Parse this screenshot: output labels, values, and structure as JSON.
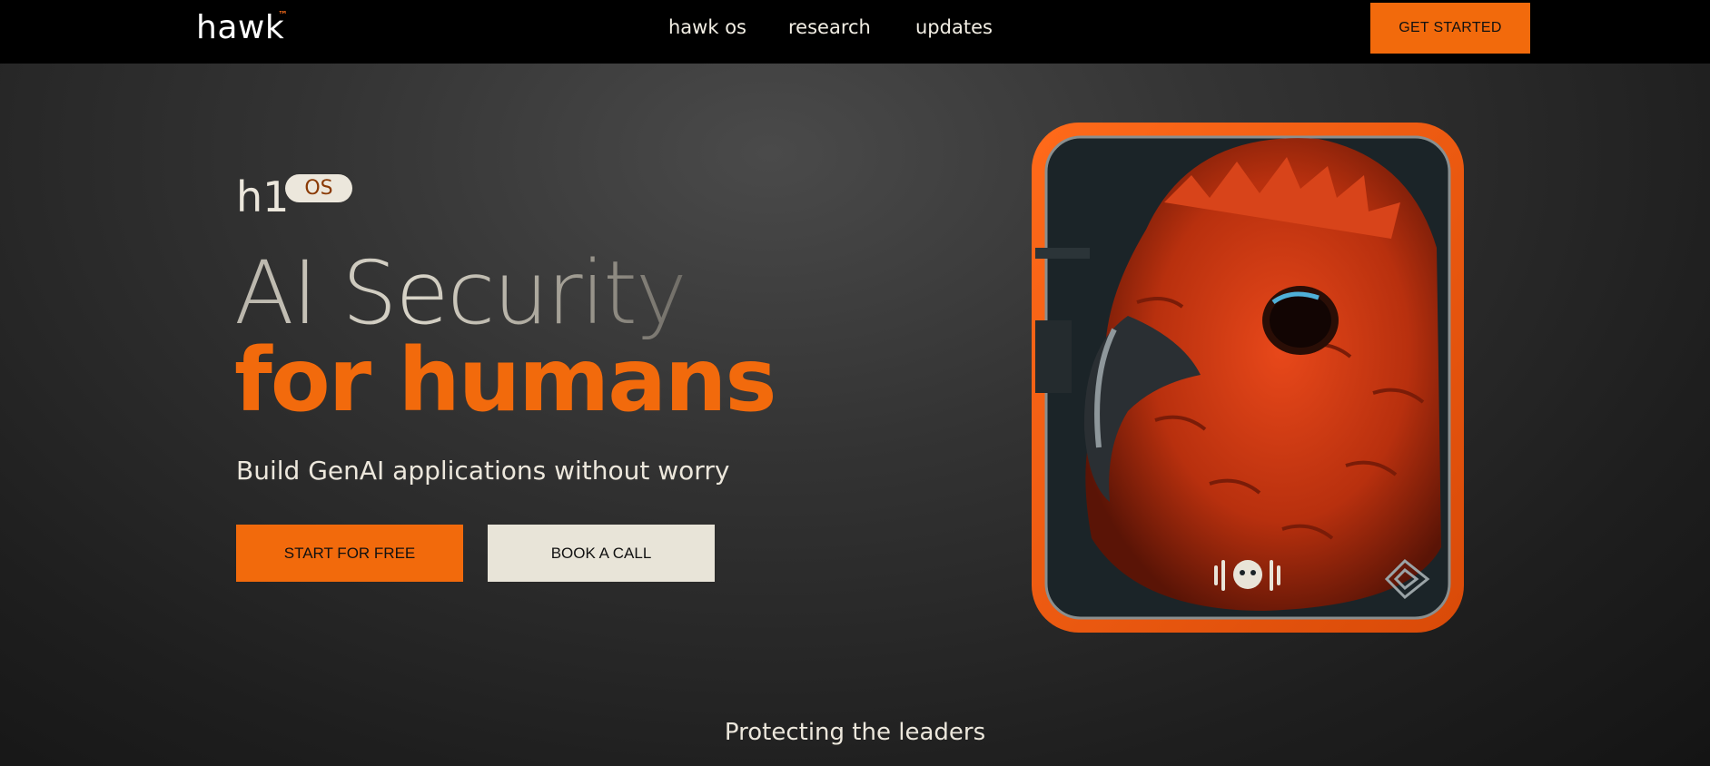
{
  "header": {
    "logo": "hawk",
    "logo_mark": "™",
    "nav": [
      "hawk os",
      "research",
      "updates"
    ],
    "cta": "GET STARTED"
  },
  "hero": {
    "tag": "h1",
    "tag_pill": "OS",
    "headline_1": "AI Security",
    "headline_2": "for humans",
    "subtitle": "Build GenAI applications without worry",
    "primary_button": "START FOR FREE",
    "secondary_button": "BOOK A CALL"
  },
  "card_image": {
    "subject": "hawk-card-illustration",
    "icons": [
      "mascot-icon",
      "shield-logo-icon"
    ]
  },
  "footer_teaser": "Protecting the leaders",
  "colors": {
    "accent": "#f26a0c",
    "light": "#e8e4d8",
    "dark": "#000000"
  }
}
